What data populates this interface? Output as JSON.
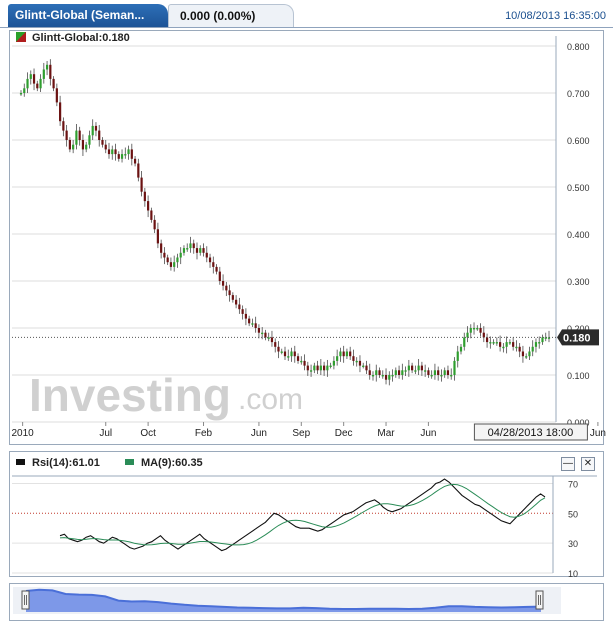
{
  "header": {
    "tab_title": "Glintt-Global (Seman...",
    "price_change": "0.000 (0.00%)",
    "timestamp": "10/08/2013 16:35:00"
  },
  "main_legend": "Glintt-Global:0.180",
  "watermark": {
    "word": "Investing",
    "suffix": ".com"
  },
  "rsi_legend": {
    "rsi": "Rsi(14):61.01",
    "ma": "MA(9):60.35"
  },
  "buttons": {
    "minimize": "—",
    "close": "✕"
  },
  "colors": {
    "up": "#2f9e2f",
    "down": "#6b1212",
    "rsi": "#111111",
    "ma": "#2a8c57",
    "accent": "#1c5295",
    "navigator": "#4a6fd8"
  },
  "chart_data": [
    {
      "type": "candlestick",
      "ylim": [
        0.0,
        0.8
      ],
      "yticks": [
        "0.000",
        "0.100",
        "0.200",
        "0.300",
        "0.400",
        "0.500",
        "0.600",
        "0.700",
        "0.800"
      ],
      "xticks": [
        {
          "label": "2010",
          "t": 0.5
        },
        {
          "label": "Jul",
          "t": 26
        },
        {
          "label": "Oct",
          "t": 39
        },
        {
          "label": "Feb",
          "t": 56
        },
        {
          "label": "Jun",
          "t": 73
        },
        {
          "label": "Sep",
          "t": 86
        },
        {
          "label": "Dec",
          "t": 99
        },
        {
          "label": "Mar",
          "t": 112
        },
        {
          "label": "Jun",
          "t": 125
        },
        {
          "label": "Jun",
          "t": 177
        }
      ],
      "crosshair": {
        "value": 0.18,
        "label": "0.180",
        "date_label": "04/28/2013 18:00",
        "t": 152
      },
      "last_value": 0.18,
      "values": [
        0.7,
        0.71,
        0.73,
        0.74,
        0.72,
        0.71,
        0.73,
        0.75,
        0.76,
        0.73,
        0.71,
        0.68,
        0.64,
        0.62,
        0.6,
        0.58,
        0.59,
        0.62,
        0.6,
        0.58,
        0.59,
        0.61,
        0.63,
        0.62,
        0.6,
        0.59,
        0.58,
        0.57,
        0.58,
        0.57,
        0.56,
        0.57,
        0.57,
        0.58,
        0.56,
        0.55,
        0.52,
        0.49,
        0.47,
        0.45,
        0.43,
        0.41,
        0.38,
        0.36,
        0.35,
        0.34,
        0.33,
        0.34,
        0.35,
        0.36,
        0.37,
        0.37,
        0.38,
        0.37,
        0.36,
        0.37,
        0.36,
        0.35,
        0.34,
        0.33,
        0.32,
        0.3,
        0.29,
        0.28,
        0.27,
        0.26,
        0.25,
        0.24,
        0.23,
        0.22,
        0.21,
        0.21,
        0.2,
        0.19,
        0.19,
        0.18,
        0.18,
        0.17,
        0.16,
        0.15,
        0.15,
        0.14,
        0.14,
        0.15,
        0.14,
        0.13,
        0.13,
        0.12,
        0.11,
        0.11,
        0.12,
        0.11,
        0.12,
        0.11,
        0.12,
        0.12,
        0.13,
        0.14,
        0.15,
        0.14,
        0.15,
        0.14,
        0.13,
        0.13,
        0.12,
        0.12,
        0.11,
        0.1,
        0.1,
        0.11,
        0.1,
        0.1,
        0.09,
        0.1,
        0.1,
        0.11,
        0.1,
        0.11,
        0.11,
        0.12,
        0.11,
        0.11,
        0.12,
        0.11,
        0.11,
        0.1,
        0.1,
        0.11,
        0.1,
        0.1,
        0.11,
        0.1,
        0.1,
        0.13,
        0.15,
        0.16,
        0.18,
        0.19,
        0.2,
        0.2,
        0.2,
        0.19,
        0.18,
        0.17,
        0.17,
        0.17,
        0.17,
        0.16,
        0.16,
        0.17,
        0.17,
        0.16,
        0.16,
        0.15,
        0.14,
        0.14,
        0.15,
        0.16,
        0.17,
        0.17,
        0.18,
        0.18,
        0.18
      ]
    },
    {
      "type": "line",
      "ylim": [
        10,
        75
      ],
      "yticks": [
        "70",
        "50",
        "30",
        "10"
      ],
      "reference_line": 50,
      "series": [
        {
          "name": "Rsi(14)",
          "values": [
            35,
            36,
            33,
            32,
            31,
            32,
            34,
            35,
            33,
            31,
            30,
            32,
            34,
            33,
            31,
            29,
            27,
            26,
            27,
            28,
            30,
            31,
            33,
            35,
            32,
            30,
            28,
            26,
            28,
            30,
            32,
            34,
            36,
            33,
            31,
            29,
            27,
            25,
            26,
            28,
            30,
            32,
            34,
            36,
            38,
            40,
            42,
            44,
            47,
            50,
            49,
            47,
            45,
            43,
            41,
            40,
            40,
            40,
            39,
            38,
            39,
            41,
            43,
            45,
            47,
            49,
            50,
            51,
            53,
            55,
            57,
            58,
            59,
            57,
            54,
            52,
            51,
            52,
            53,
            55,
            57,
            59,
            61,
            63,
            65,
            67,
            70,
            71,
            73,
            71,
            68,
            65,
            62,
            60,
            58,
            56,
            55,
            53,
            51,
            49,
            47,
            45,
            44,
            43,
            46,
            49,
            52,
            55,
            58,
            61,
            63,
            61
          ]
        },
        {
          "name": "MA(9)",
          "values": [
            33.5,
            33.7,
            33.3,
            32.9,
            32.5,
            32.3,
            32.6,
            33.0,
            33.1,
            32.8,
            32.4,
            32.1,
            32.1,
            32.1,
            31.8,
            31.4,
            30.8,
            30.0,
            29.4,
            29.0,
            28.8,
            28.9,
            29.3,
            29.8,
            30.0,
            29.9,
            29.6,
            29.3,
            29.3,
            29.6,
            30.1,
            30.6,
            31.1,
            31.1,
            30.9,
            30.6,
            30.2,
            29.8,
            29.4,
            29.0,
            28.8,
            28.8,
            29.0,
            29.6,
            30.6,
            32.0,
            33.7,
            35.6,
            37.6,
            39.8,
            41.8,
            43.4,
            44.6,
            45.2,
            45.4,
            45.1,
            44.5,
            43.6,
            42.7,
            41.8,
            41.0,
            40.6,
            40.7,
            41.3,
            42.3,
            43.6,
            45.1,
            46.7,
            48.4,
            50.2,
            51.9,
            53.5,
            54.9,
            55.9,
            56.4,
            56.4,
            56.0,
            55.4,
            54.9,
            54.8,
            55.2,
            56.0,
            57.2,
            58.7,
            60.4,
            62.3,
            64.4,
            66.3,
            68.0,
            69.0,
            69.4,
            69.1,
            68.1,
            66.6,
            64.7,
            62.7,
            60.6,
            58.5,
            56.4,
            54.4,
            52.4,
            50.6,
            49.0,
            47.7,
            47.4,
            48.0,
            49.3,
            51.2,
            53.6,
            56.2,
            58.7,
            60.4
          ]
        }
      ]
    },
    {
      "type": "area",
      "values": [
        0.7,
        0.74,
        0.72,
        0.6,
        0.58,
        0.57,
        0.52,
        0.38,
        0.35,
        0.36,
        0.33,
        0.28,
        0.24,
        0.21,
        0.19,
        0.17,
        0.15,
        0.14,
        0.13,
        0.12,
        0.12,
        0.14,
        0.13,
        0.11,
        0.1,
        0.1,
        0.11,
        0.11,
        0.11,
        0.1,
        0.11,
        0.14,
        0.19,
        0.19,
        0.17,
        0.16,
        0.15,
        0.16,
        0.17,
        0.18
      ]
    }
  ]
}
